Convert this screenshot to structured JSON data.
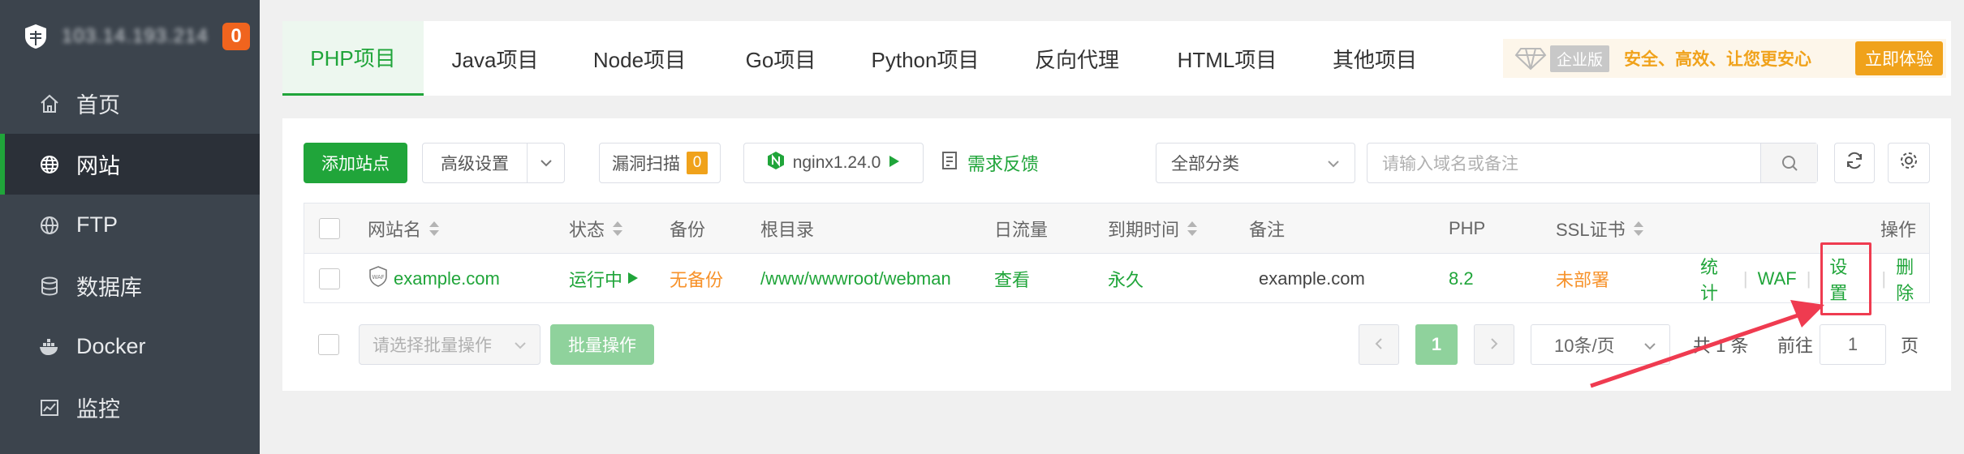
{
  "sidebar": {
    "server_ip": "103.14.193.214",
    "notify_count": "0",
    "items": [
      {
        "label": "首页",
        "icon": "home-icon"
      },
      {
        "label": "网站",
        "icon": "globe-icon"
      },
      {
        "label": "FTP",
        "icon": "ftp-globe-icon"
      },
      {
        "label": "数据库",
        "icon": "database-icon"
      },
      {
        "label": "Docker",
        "icon": "docker-icon"
      },
      {
        "label": "监控",
        "icon": "monitor-chart-icon"
      }
    ]
  },
  "tabs": [
    {
      "label": "PHP项目"
    },
    {
      "label": "Java项目"
    },
    {
      "label": "Node项目"
    },
    {
      "label": "Go项目"
    },
    {
      "label": "Python项目"
    },
    {
      "label": "反向代理"
    },
    {
      "label": "HTML项目"
    },
    {
      "label": "其他项目"
    }
  ],
  "promo": {
    "edition": "企业版",
    "slogan": "安全、高效、让您更安心",
    "cta": "立即体验"
  },
  "toolbar": {
    "add_site": "添加站点",
    "advanced": "高级设置",
    "vuln_scan": "漏洞扫描",
    "vuln_count": "0",
    "nginx": "nginx1.24.0",
    "feedback": "需求反馈",
    "category": "全部分类",
    "search_placeholder": "请输入域名或备注"
  },
  "table": {
    "headers": {
      "name": "网站名",
      "status": "状态",
      "backup": "备份",
      "root": "根目录",
      "traffic": "日流量",
      "expire": "到期时间",
      "remark": "备注",
      "php": "PHP",
      "ssl": "SSL证书",
      "ops": "操作"
    },
    "rows": [
      {
        "name": "example.com",
        "waf_tag": "WAF",
        "status": "运行中",
        "backup": "无备份",
        "root": "/www/wwwroot/webman",
        "traffic": "查看",
        "expire": "永久",
        "remark": "example.com",
        "php": "8.2",
        "ssl": "未部署",
        "ops": {
          "stats": "统计",
          "waf": "WAF",
          "settings": "设置",
          "delete": "删除"
        }
      }
    ]
  },
  "footer": {
    "batch_placeholder": "请选择批量操作",
    "batch_button": "批量操作",
    "current_page": "1",
    "per_page": "10条/页",
    "total": "共 1 条",
    "goto_label": "前往",
    "goto_value": "1",
    "page_unit": "页"
  },
  "colors": {
    "brand_green": "#20a53a",
    "sidebar_bg": "#3c444d",
    "warning_orange": "#f7922a",
    "highlight_red": "#ef4444"
  }
}
